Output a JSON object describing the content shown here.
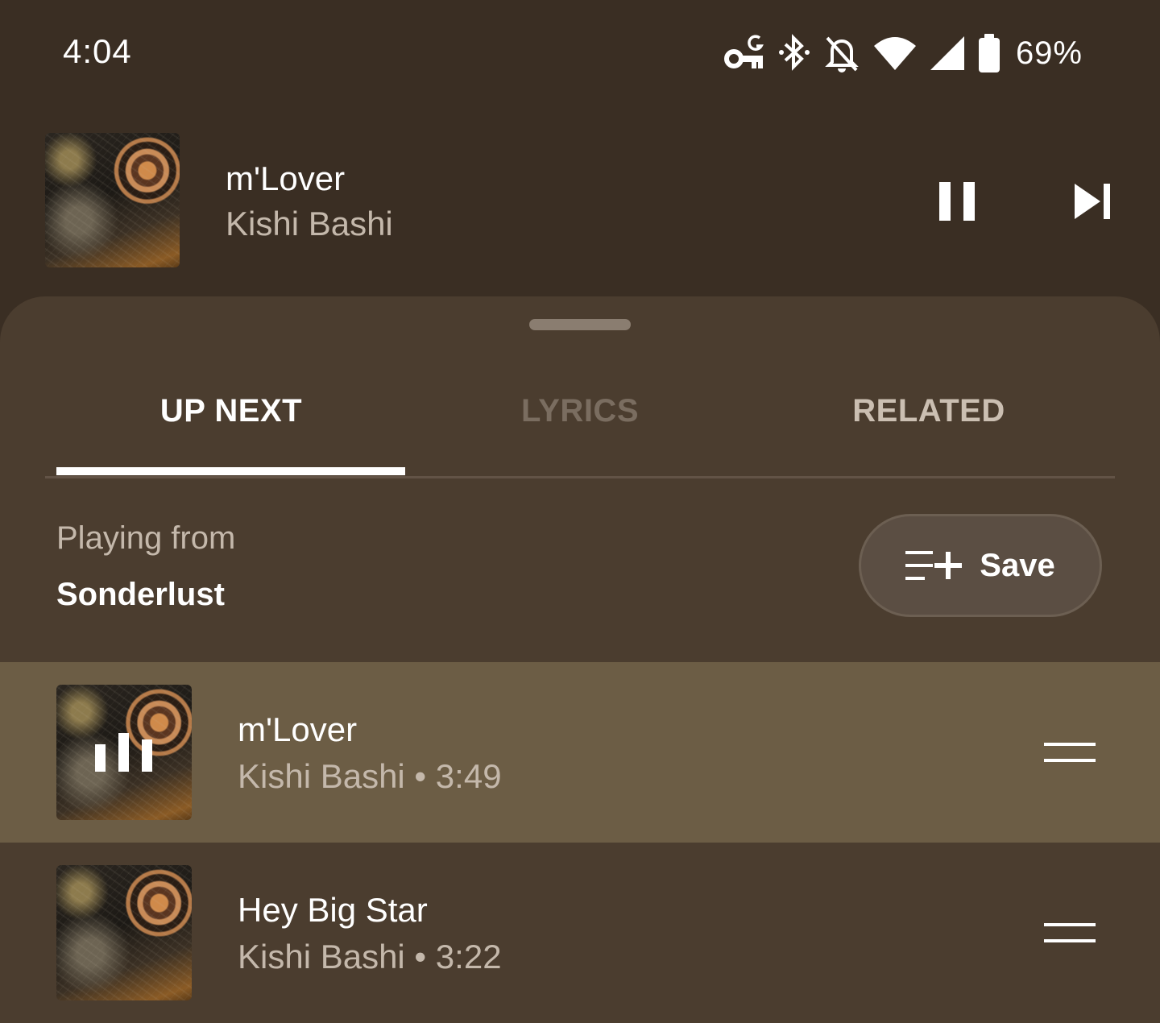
{
  "status_bar": {
    "time": "4:04",
    "battery_percent": "69%",
    "icons": [
      "vpn-key-icon",
      "bluetooth-icon",
      "notifications-off-icon",
      "wifi-icon",
      "cell-signal-icon",
      "battery-icon"
    ]
  },
  "now_playing": {
    "title": "m'Lover",
    "artist": "Kishi Bashi",
    "controls": [
      "pause-icon",
      "skip-next-icon"
    ]
  },
  "tabs": [
    {
      "label": "UP NEXT",
      "selected": true
    },
    {
      "label": "LYRICS",
      "selected": false
    },
    {
      "label": "RELATED",
      "selected": false
    }
  ],
  "queue_header": {
    "playing_from_label": "Playing from",
    "playlist_name": "Sonderlust",
    "save_label": "Save"
  },
  "queue": [
    {
      "title": "m'Lover",
      "subtitle": "Kishi Bashi • 3:49",
      "now_playing": true
    },
    {
      "title": "Hey Big Star",
      "subtitle": "Kishi Bashi • 3:22",
      "now_playing": false
    }
  ],
  "colors": {
    "background": "#3a2e23",
    "sheet": "#4b3d2f",
    "active_row": "#6c5d45",
    "secondary_text": "#c4b8ab",
    "inactive_tab": "#7a6d60"
  }
}
